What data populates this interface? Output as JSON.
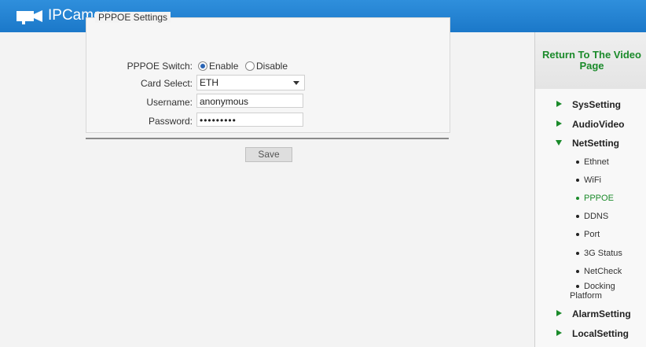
{
  "header": {
    "title": "IPCamera"
  },
  "form": {
    "legend": "PPPOE Settings",
    "switch_label": "PPPOE Switch:",
    "enable_label": "Enable",
    "disable_label": "Disable",
    "switch_value": "Enable",
    "card_label": "Card Select:",
    "card_value": "ETH",
    "username_label": "Username:",
    "username_value": "anonymous",
    "password_label": "Password:",
    "password_value": "•••••••••",
    "save_label": "Save"
  },
  "sidebar": {
    "return_label": "Return To The Video Page",
    "menu": [
      "SysSetting",
      "AudioVideo",
      "NetSetting",
      "AlarmSetting",
      "LocalSetting"
    ],
    "net_items": [
      "Ethnet",
      "WiFi",
      "PPPOE",
      "DDNS",
      "Port",
      "3G Status",
      "NetCheck",
      "Docking Platform"
    ],
    "active_item": "PPPOE"
  },
  "colors": {
    "header": "#1b78c9",
    "accent": "#1a8a2a"
  }
}
